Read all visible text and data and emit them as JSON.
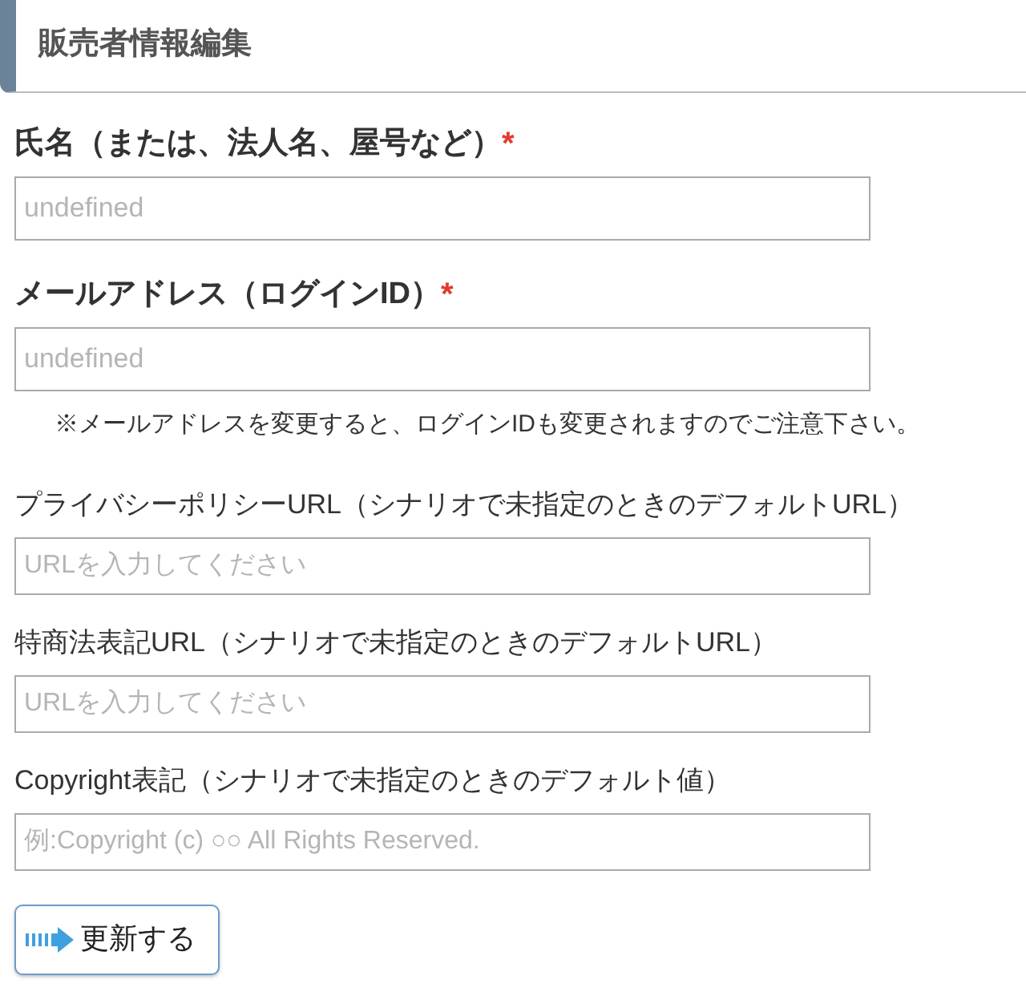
{
  "header": {
    "title": "販売者情報編集"
  },
  "fields": [
    {
      "label": "氏名（または、法人名、屋号など）",
      "required": true,
      "placeholder": "undefined"
    },
    {
      "label": "メールアドレス（ログインID）",
      "required": true,
      "placeholder": "undefined",
      "note": "※メールアドレスを変更すると、ログインIDも変更されますのでご注意下さい。"
    },
    {
      "label": "プライバシーポリシーURL（シナリオで未指定のときのデフォルトURL）",
      "required": false,
      "placeholder": "URLを入力してください"
    },
    {
      "label": "特商法表記URL（シナリオで未指定のときのデフォルトURL）",
      "required": false,
      "placeholder": "URLを入力してください"
    },
    {
      "label": "Copyright表記（シナリオで未指定のときのデフォルト値）",
      "required": false,
      "placeholder": "例:Copyright (c) ○○ All Rights Reserved."
    }
  ],
  "required_mark": "*",
  "submit_button": {
    "label": "更新する"
  }
}
